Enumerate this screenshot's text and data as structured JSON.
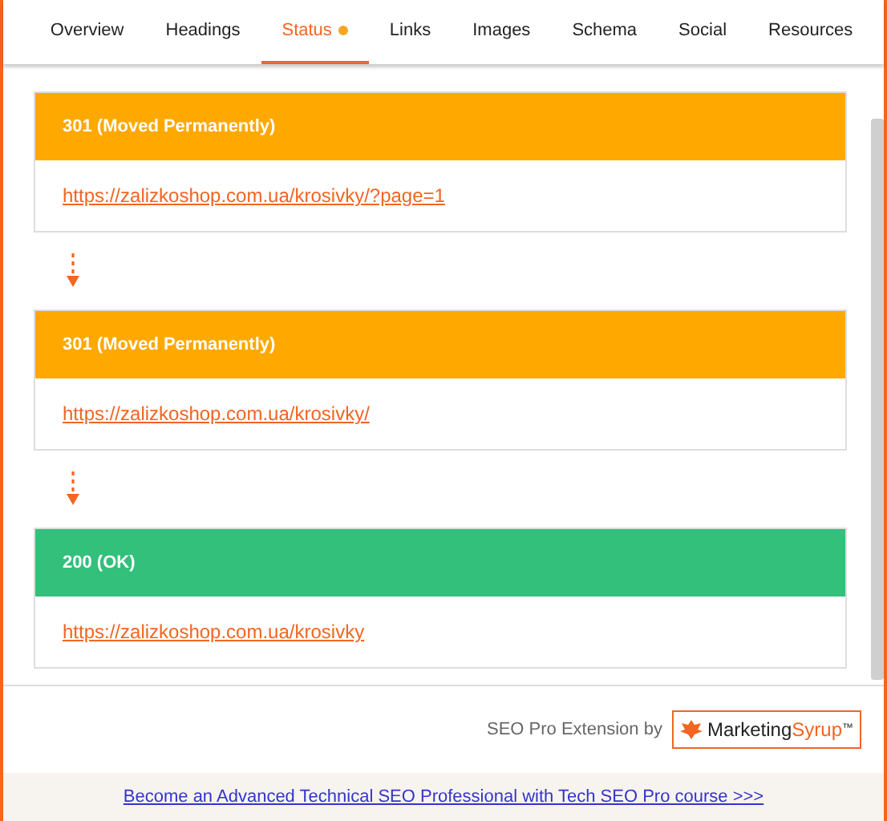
{
  "tabs": [
    {
      "label": "Overview",
      "selected": false,
      "dot": false
    },
    {
      "label": "Headings",
      "selected": false,
      "dot": false
    },
    {
      "label": "Status",
      "selected": true,
      "dot": true
    },
    {
      "label": "Links",
      "selected": false,
      "dot": false
    },
    {
      "label": "Images",
      "selected": false,
      "dot": false
    },
    {
      "label": "Schema",
      "selected": false,
      "dot": false
    },
    {
      "label": "Social",
      "selected": false,
      "dot": false
    },
    {
      "label": "Resources",
      "selected": false,
      "dot": false
    }
  ],
  "redirects": [
    {
      "kind": "redirect",
      "status": "301 (Moved Permanently)",
      "url": "https://zalizkoshop.com.ua/krosivky/?page=1"
    },
    {
      "kind": "redirect",
      "status": "301 (Moved Permanently)",
      "url": "https://zalizkoshop.com.ua/krosivky/"
    },
    {
      "kind": "ok",
      "status": "200 (OK)",
      "url": "https://zalizkoshop.com.ua/krosivky"
    }
  ],
  "footer": {
    "credit": "SEO Pro Extension by",
    "logo_first": "Marketing",
    "logo_second": "Syrup",
    "logo_mark": "™"
  },
  "promo_link": "Become an Advanced Technical SEO Professional with Tech SEO Pro course >>>"
}
